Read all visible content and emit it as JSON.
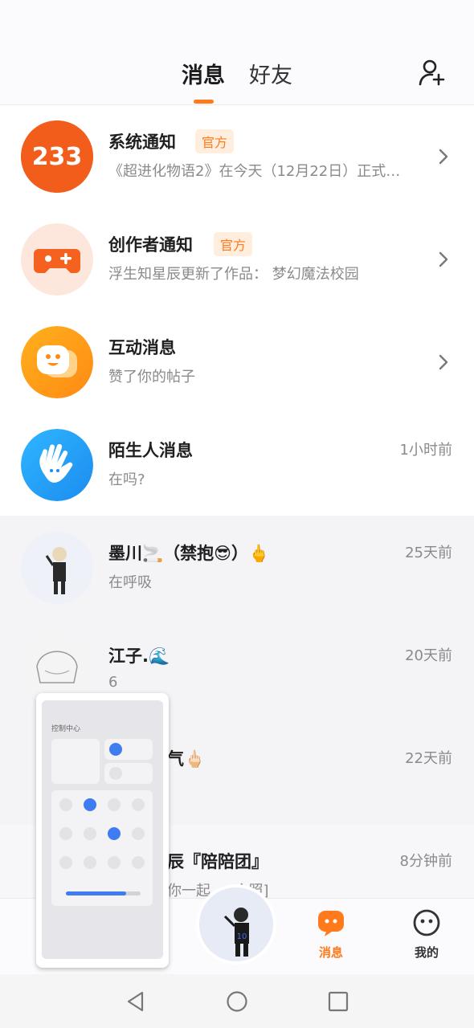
{
  "header": {
    "tabs": [
      {
        "label": "消息",
        "active": true
      },
      {
        "label": "好友",
        "active": false
      }
    ],
    "add_friend_icon": "add-user-icon",
    "accent_color": "#ff7a1a"
  },
  "messages": [
    {
      "name": "系统通知",
      "badge": "官方",
      "preview": "《超进化物语2》在今天（12月22日）正式…",
      "avatar": "233-logo",
      "has_chevron": true
    },
    {
      "name": "创作者通知",
      "badge": "官方",
      "preview": "浮生知星辰更新了作品：  梦幻魔法校园",
      "avatar": "gamepad-icon",
      "has_chevron": true
    },
    {
      "name": "互动消息",
      "preview": "赞了你的帖子",
      "avatar": "chat-bubble-icon",
      "has_chevron": true
    },
    {
      "name": "陌生人消息",
      "preview": "在吗?",
      "time": "1小时前",
      "avatar": "waving-hand-icon"
    },
    {
      "name": "墨川🚬（禁抱😎）🖕",
      "preview": "在呼吸",
      "time": "25天前",
      "avatar": "anime-boy"
    },
    {
      "name": "江子.🌊",
      "preview": "6",
      "time": "20天前",
      "avatar": "anime-sketch"
    },
    {
      "name": "气🖕🏻",
      "preview": "",
      "time": "22天前",
      "avatar": "hidden"
    },
    {
      "name": "辰『陪陪团』",
      "preview": "你一起 … 会照]",
      "time": "8分钟前",
      "avatar": "hidden"
    }
  ],
  "bottom_nav": {
    "items": [
      {
        "label": "消息",
        "icon": "message-icon",
        "active": true
      },
      {
        "label": "我的",
        "icon": "smiley-face-icon",
        "active": false
      }
    ]
  },
  "overlay": {
    "title": "控制中心"
  },
  "system_nav": [
    "back-icon",
    "home-icon",
    "recents-icon"
  ]
}
